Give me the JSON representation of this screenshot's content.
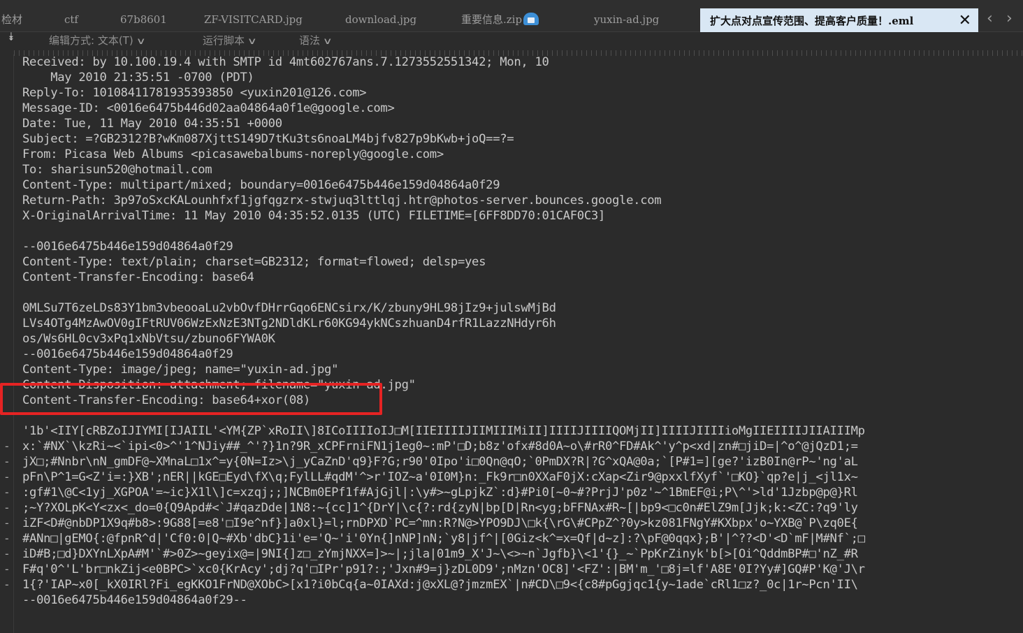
{
  "tabs": [
    {
      "label": "检材"
    },
    {
      "label": "ctf"
    },
    {
      "label": "67b8601"
    },
    {
      "label": "ZF-VISITCARD.jpg"
    },
    {
      "label": "download.jpg"
    },
    {
      "label": "重要信息.zip"
    },
    {
      "label": "yuxin-ad.jpg"
    },
    {
      "label": "扩大点对点宣传范围、提高客户质量！.eml"
    }
  ],
  "tab_close": "✕",
  "nav": {
    "prev": "‹",
    "next": "›"
  },
  "toolbar": {
    "collapse_icon": "⯯",
    "edit_mode": "编辑方式: 文本(T)",
    "run_script": "运行脚本",
    "syntax": "语法",
    "chevron": "∨"
  },
  "editor": {
    "lines": [
      "Received: by 10.100.19.4 with SMTP id 4mt602767ans.7.1273552551342; Mon, 10",
      "    May 2010 21:35:51 -0700 (PDT)",
      "Reply-To: 10108411781935393850 <yuxin201@126.com>",
      "Message-ID: <0016e6475b446d02aa04864a0f1e@google.com>",
      "Date: Tue, 11 May 2010 04:35:51 +0000",
      "Subject: =?GB2312?B?wKm087XjttS149D7tKu3ts6noaLM4bjfv827p9bKwb+joQ==?=",
      "From: Picasa Web Albums <picasawebalbums-noreply@google.com>",
      "To: sharisun520@hotmail.com",
      "Content-Type: multipart/mixed; boundary=0016e6475b446e159d04864a0f29",
      "Return-Path: 3p97oSxcKALounhfxf1jgfqgzrx-stwjuq3lttlqj.htr@photos-server.bounces.google.com",
      "X-OriginalArrivalTime: 11 May 2010 04:35:52.0135 (UTC) FILETIME=[6FF8DD70:01CAF0C3]",
      "",
      "--0016e6475b446e159d04864a0f29",
      "Content-Type: text/plain; charset=GB2312; format=flowed; delsp=yes",
      "Content-Transfer-Encoding: base64",
      "",
      "0MLSu7T6zeLDs83Y1bm3vbeooaLu2vbOvfDHrrGqo6ENCsirx/K/zbuny9HL98jIz9+julswMjBd",
      "LVs4OTg4MzAwOV0gIFtRUV06WzExNzE3NTg2NDldKLr60KG94ykNCszhuanD4rfR1LazzNHdyr6h",
      "os/Ws6HL0cv3xPq1xNbVtsu/zbuno6FYWA0K",
      "--0016e6475b446e159d04864a0f29",
      "Content-Type: image/jpeg; name=\"yuxin-ad.jpg\"",
      "Content-Disposition: attachment; filename=\"yuxin-ad.jpg\"",
      "Content-Transfer-Encoding: base64+xor(08)",
      "",
      "'1b'<IIY[cRBZoIJIYMI[IJAIIL'<YM{ZP`xRoII\\]8ICoIIIIoIJ□M[IIEIIIIJIIMIIIMiII]IIIIJIIIIQOMjII]IIIIJIIIIioMgIIEIIIIJIIAIIIMp",
      "x:`#NX`\\kzRi~<`ipi<0>^'1^NJiy##_^'?}1n?9R_xCPFrniFN1j1eg0~:mP'□D;b8z'ofx#8d0A~o\\#rR0^FD#Ak^'y^p<xd|zn#□jiD=|^o^@jQzD1;=",
      "jX□;#Nnbr\\nN_gmDF@~XMnaL□1x^=y{0N=Iz>\\j_yCaZnD'q9}F?G;r90'0Ipo'i□0Qn@qO;`0PmDX?R|?G^xQA@0a;`[P#1=][ge?'izB0In@rP~'ng'aL",
      "pFn\\P^1=G<Z'i=:}XB';nER||kGE□Eyd\\fX\\q;FylLL#qdM'^>r'IOZ~a'0I0M}n:_Fk9r□n0XXaF0jX:cXap<Zir9@pxxlfXyf`'□KO}`qp?e|j_<jl1x~",
      ":gf#1\\@C<1yj_XGPOA'=~ic}X1l\\]c=xzqj;;]NCBm0EPf1f#AjGjl|:\\y#>~gLpjkZ`:d}#Pi0[~0~#?PrjJ'p0z'~^1BmEF@i;P\\^'>ld'1Jzbp@p@}Rl",
      ";~Y?XOLpK<Y<zx<_do=0{Q9Apd#<`J#qazDde|1N8:~{cc]1^{DrY|\\c{?:rd{zyN|bp[D|Rn<yg;bFFNAx#R~[|bp9<□c0n#ElZ9m[Jjk;k:<ZC:?q9'ly",
      "iZF<D#@nbDP1X9q#b8>:9G88[=e8'□I9e^nf}]a0xl}=l;rnDPXD`PC=^mn:R?N@>YPO9DJ\\□k{\\rG\\#CPpZ^?0y>kz081FNgY#KXbpx'o~YXB@`P\\zq0E{",
      "#ANn□|gEMO{:@fpnR^d|'Cf0:0|Q~#Xb'dbC}1i'e='Q~'i'0Yn{]nNP]nN;`y8|jf^|[0Giz<k^=x=Qf|d~z]:?\\pF@0qqx};B'|^??<D'<D`mF|M#Nf`;□",
      "iD#B;□d}DXYnLXpA#M'`#>0Z>~geyix@=|9NI{]z□_zYmjNXX=]>~|;jla|01m9_X'J~\\<>~n`Jgfb}\\<1'{}_~`PpKrZinyk'b[>[Oi^QddmBP#□'nZ_#R",
      "F#q'0^'L'br□nkZij<e0BPC>`xc0{KrAcy';dj?q'□IPr'p91?:;'Jxn#9=j}zDL0D9';nMzn'OC8]'<FZ':|BM'm_'□8j=lf'A8E'0I?Yy#]GQ#P'K@'J\\r",
      "1{?'IAP~x0[_kX0IRl?Fi_egKKO1FrND@XObC>[x1?i0bCq{a~0IAXd:j@xXL@?jmzmEX`|n#CD\\□9<{c8#pGgjqc1{y~1ade`cRl1□z?_0c|1r~Pcn'II\\",
      "--0016e6475b446e159d04864a0f29--"
    ]
  }
}
